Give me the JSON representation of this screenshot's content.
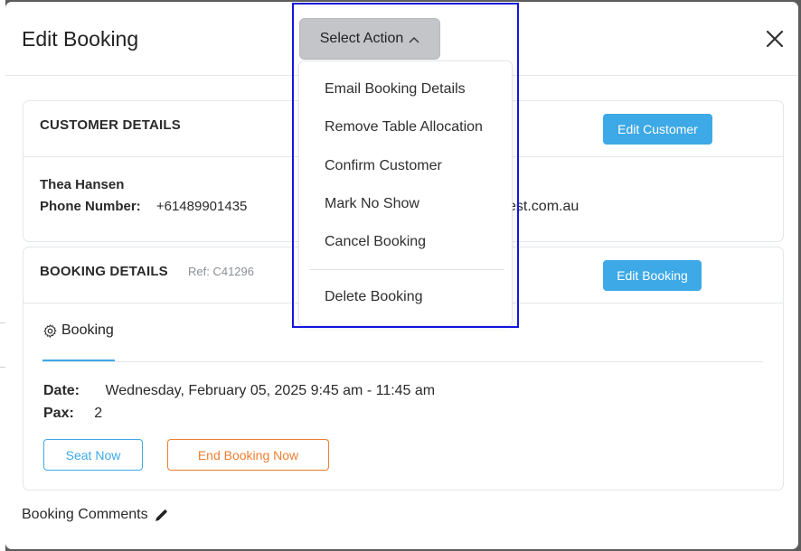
{
  "modal": {
    "title": "Edit Booking",
    "action_button": "Select Action"
  },
  "customer": {
    "section_title": "CUSTOMER DETAILS",
    "edit_button": "Edit Customer",
    "name": "Thea Hansen",
    "phone_label": "Phone Number:",
    "phone": "+61489901435",
    "email_visible": "est.com.au"
  },
  "booking": {
    "section_title": "BOOKING DETAILS",
    "ref": "Ref: C41296",
    "edit_button": "Edit Booking",
    "tab_label": "Booking",
    "date_label": "Date:",
    "date_value": "Wednesday, February 05, 2025 9:45 am - 11:45 am",
    "pax_label": "Pax:",
    "pax_value": "2",
    "seat_button": "Seat Now",
    "end_button": "End Booking Now"
  },
  "comments": {
    "label": "Booking Comments"
  },
  "dropdown": {
    "items": [
      "Email Booking Details",
      "Remove Table Allocation",
      "Confirm Customer",
      "Mark No Show",
      "Cancel Booking"
    ],
    "danger_item": "Delete Booking"
  },
  "icons": {
    "close": "close-icon",
    "chevron": "chevron-up-icon",
    "settings": "gear-icon",
    "edit": "pencil-icon"
  },
  "colors": {
    "accent": "#3da9e6",
    "warning": "#ef7d2f",
    "highlight": "#1515e0"
  }
}
